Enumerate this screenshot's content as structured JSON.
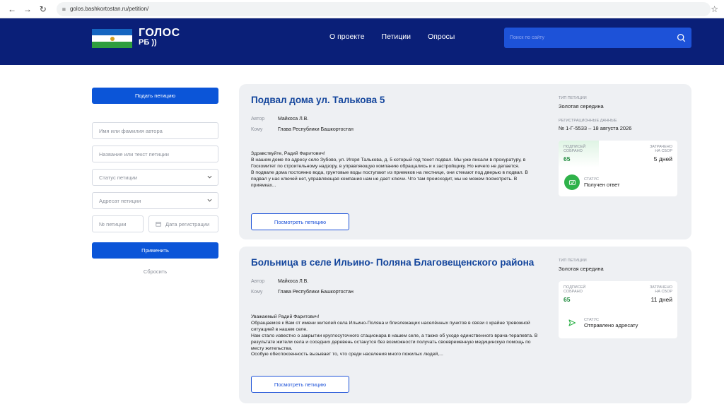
{
  "browser": {
    "url": "golos.bashkortostan.ru/petition/"
  },
  "header": {
    "logo_title": "ГОЛОС",
    "logo_sub": "РБ",
    "nav": [
      "О проекте",
      "Петиции",
      "Опросы"
    ],
    "search_placeholder": "Поиск по сайту"
  },
  "sidebar": {
    "submit_label": "Подать петицию",
    "author_placeholder": "Имя или фамилия автора",
    "name_placeholder": "Название или текст петиции",
    "status_placeholder": "Статус петиции",
    "addressee_placeholder": "Адресат петиции",
    "number_placeholder": "№ петиции",
    "date_placeholder": "Дата регистрации",
    "apply_label": "Применить",
    "reset_label": "Сбросить"
  },
  "labels": {
    "author": "Автор",
    "to": "Кому",
    "type": "ТИП ПЕТИЦИИ",
    "reg": "РЕГИСТРАЦИОННЫЕ ДАННЫЕ",
    "signatures_1": "ПОДПИСЕЙ",
    "signatures_2": "СОБРАНО",
    "spent_1": "ЗАТРАЧЕНО",
    "spent_2": "НА СБОР",
    "status": "СТАТУС",
    "view": "Посмотреть петицию"
  },
  "petitions": [
    {
      "title": "Подвал дома ул. Талькова 5",
      "author": "Майкоса Л.В.",
      "to": "Глава Республики Башкортостан",
      "body": [
        "Здравствуйте, Радий Фаритович!",
        "В нашем доме по адресу село Зубово, ул. Игоря Талькова, д. 5 который год тонет подвал. Мы уже писали в прокуратуру, в Госкомитет по строительному надзору, в управляющую компанию обращались и к застройщику. Но ничего не делается.",
        "В подвале дома постоянно вода, грунтовые воды поступают из приемков на лестнице, они стекают под дверью в подвал. В подвал у нас ключей нет, управляющая компания нам не дает ключи. Что там происходит, мы не можем посмотреть. В приямках..."
      ],
      "type": "Золотая середина",
      "reg": "№ 1-Г-5533 – 18 августа 2026",
      "signatures": "65",
      "days": "5 дней",
      "status": "Получен ответ"
    },
    {
      "title": "Больница в селе Ильино- Поляна Благовещенского района",
      "author": "Майкоса Л.В.",
      "to": "Глава Республики Башкортостан",
      "body": [
        "Уважаемый Радий Фаритович!",
        "Обращаемся к Вам от имени жителей села Ильино-Поляна и близлежащих населённых пунктов в связи с крайне тревожной ситуацией в нашем селе.",
        "Нам стало известно о закрытии круглосуточного стационара в нашем селе, а также об уходе единственного врача-терапевта. В результате жители села и соседних деревень останутся без возможности получать своевременную медицинскую помощь по месту жительства.",
        "Особую обеспокоенность вызывает то, что среди населения много пожилых людей,..."
      ],
      "type": "Золотая середина",
      "signatures": "65",
      "days": "11 дней",
      "status": "Отправлено адресату"
    }
  ]
}
